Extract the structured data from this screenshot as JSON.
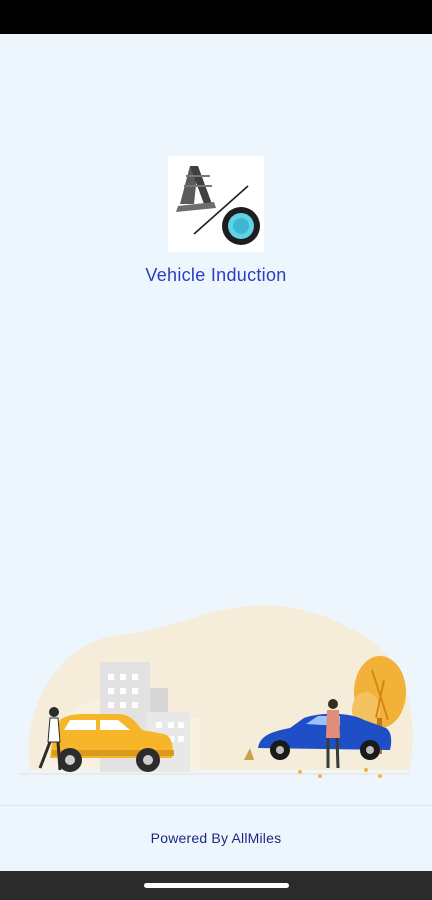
{
  "app": {
    "title": "Vehicle Induction",
    "logo_icon": "road-wheel-logo-icon"
  },
  "illustration": {
    "name": "cars-city-illustration",
    "colors": {
      "blob": "#f5ecd9",
      "yellow_car": "#f7b52a",
      "blue_car": "#1e4fc7",
      "tree": "#f2b23a",
      "building": "#e4e4e4"
    }
  },
  "footer": {
    "powered_by": "Powered By AllMiles"
  },
  "colors": {
    "background": "#eef6fd",
    "accent": "#2e3bc4",
    "footer_text": "#1b2a80"
  }
}
